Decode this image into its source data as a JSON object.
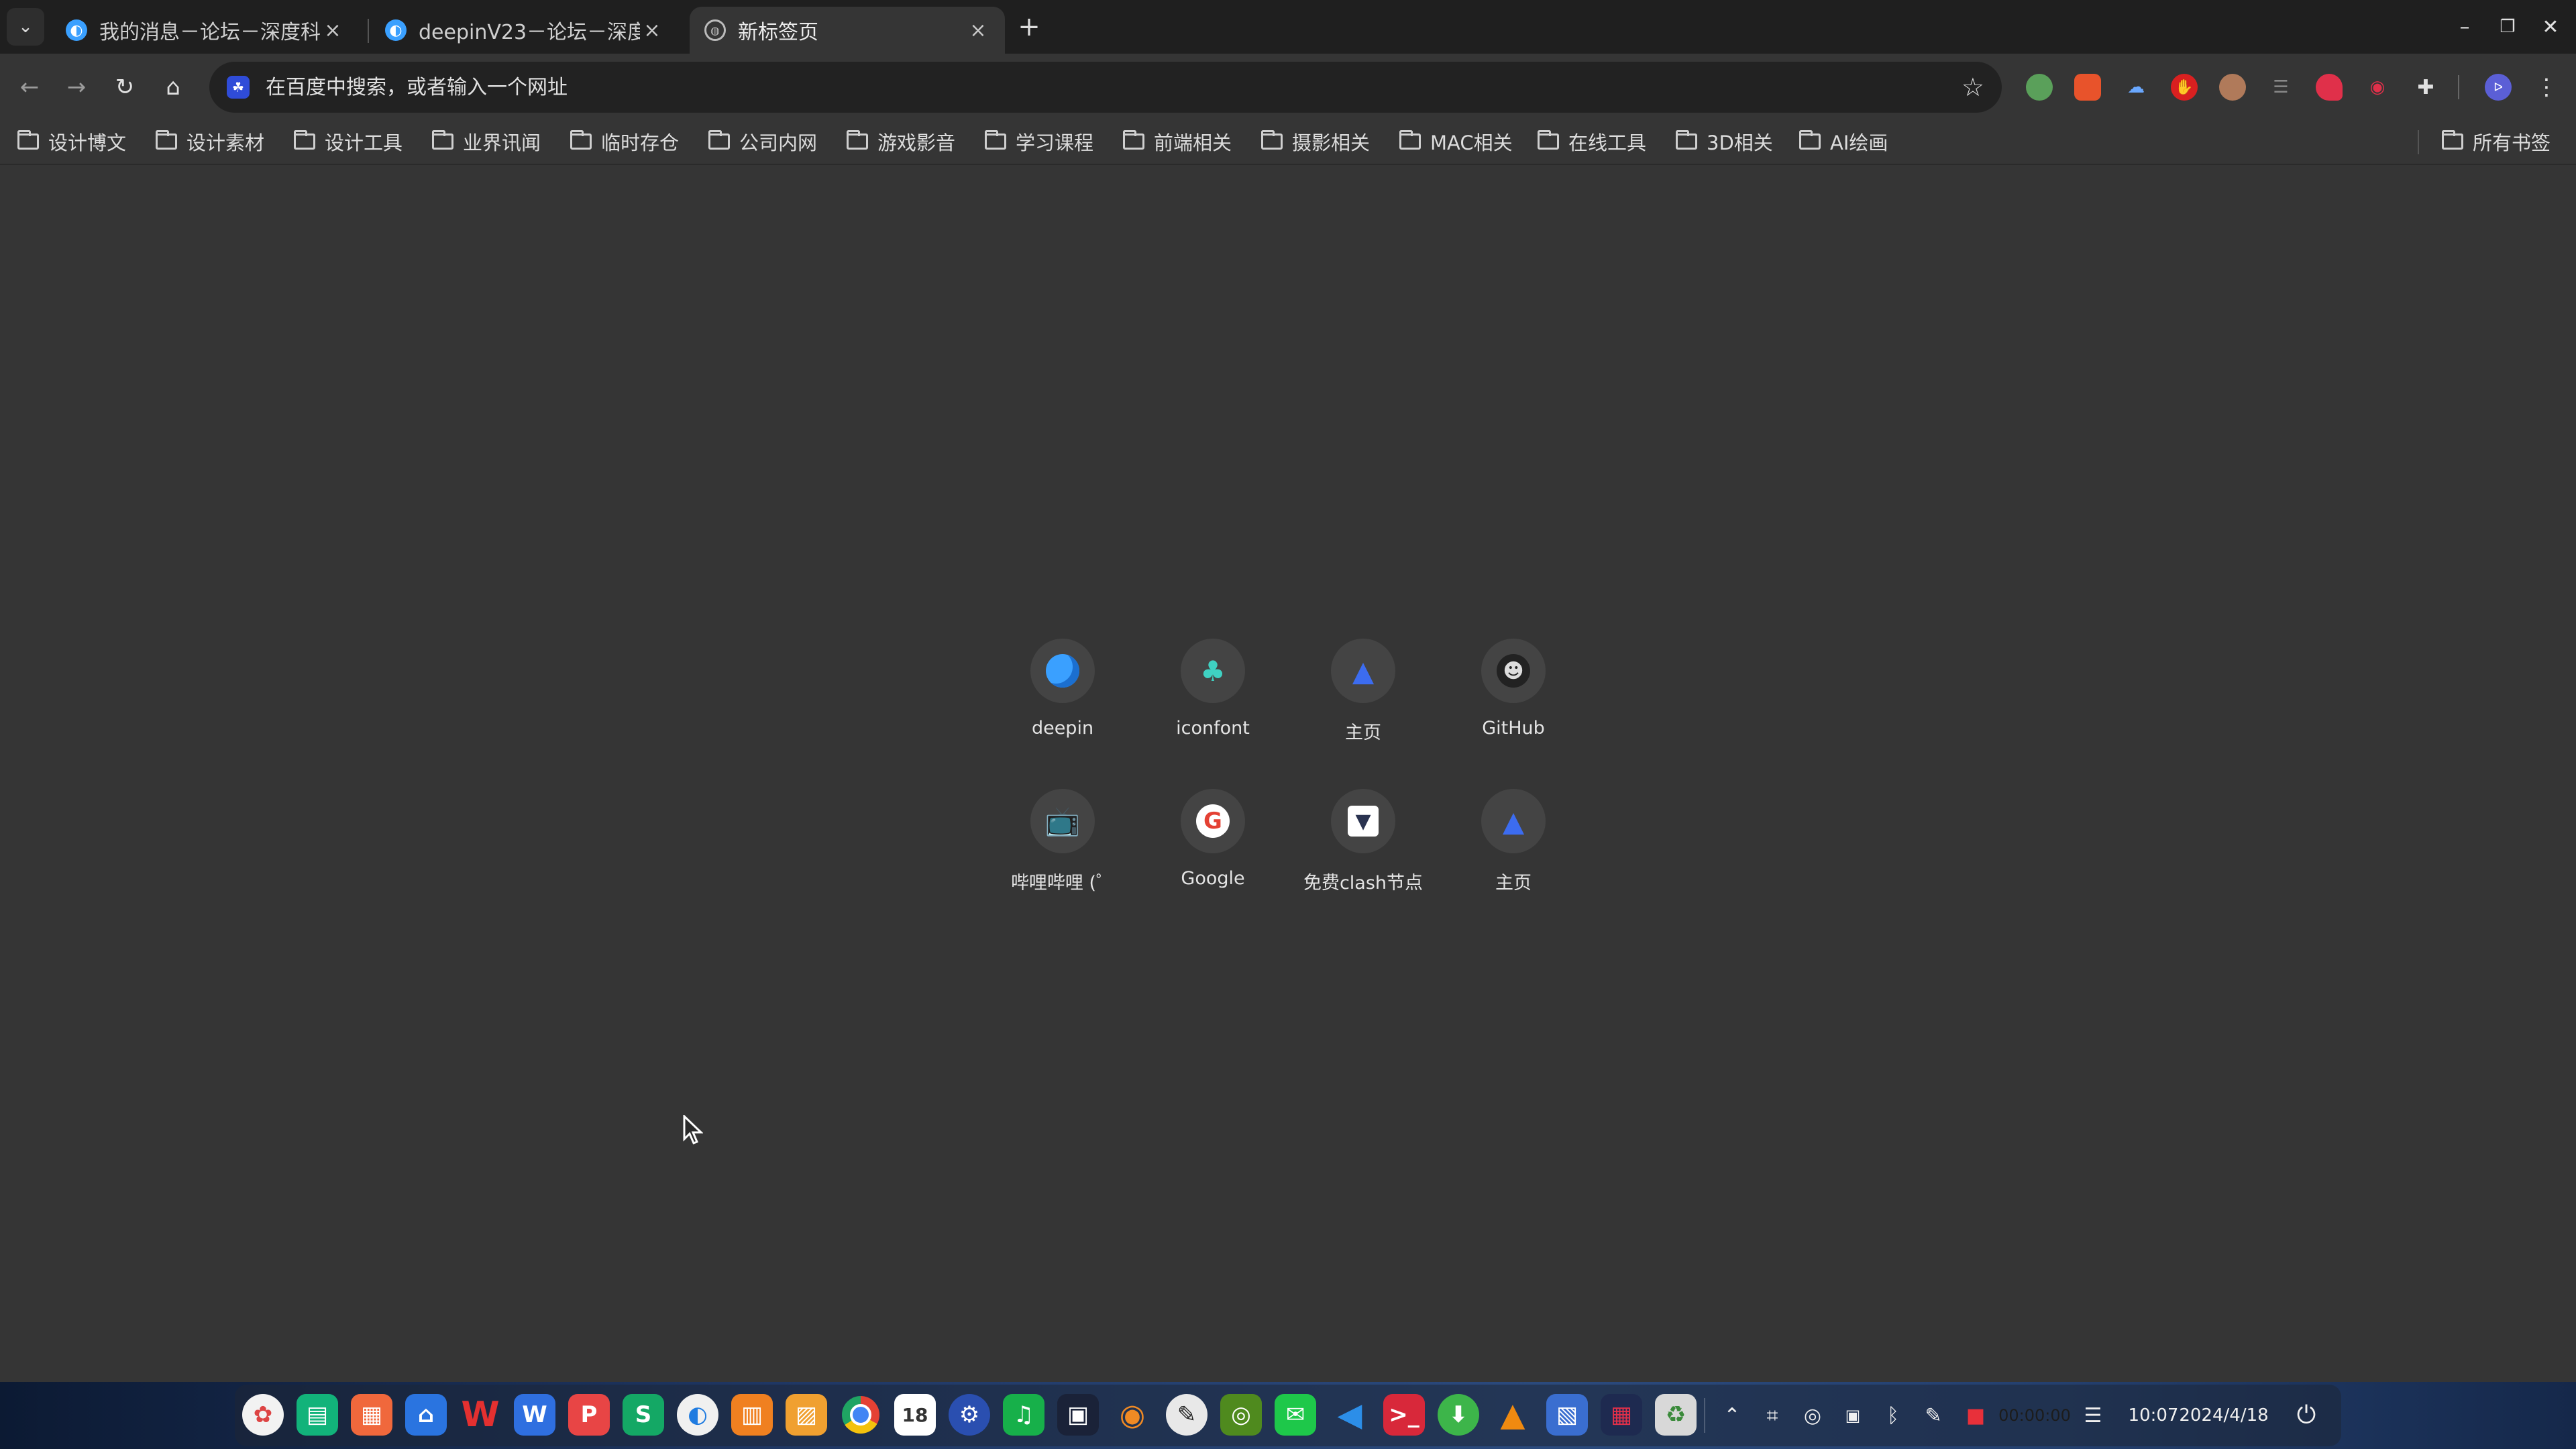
{
  "tabs": [
    {
      "title": "我的消息－论坛－深度科",
      "close": "×"
    },
    {
      "title": "deepinV23－论坛－深度",
      "close": "×"
    },
    {
      "title": "新标签页",
      "close": "×"
    }
  ],
  "tab_strip": {
    "dropdown": "⌄",
    "new_tab": "+"
  },
  "window_controls": {
    "minimize": "–",
    "maximize": "❐",
    "close": "✕"
  },
  "toolbar": {
    "back": "←",
    "forward": "→",
    "reload": "↻",
    "home": "⌂",
    "omnibox_placeholder": "在百度中搜索，或者输入一个网址",
    "search_engine_icon": "baidu-icon",
    "bookmark_star": "☆",
    "extensions_icon": "puzzle-icon",
    "profile_letter": "ᐅ",
    "menu": "⋮"
  },
  "bookmarks": [
    "设计博文",
    "设计素材",
    "设计工具",
    "业界讯闻",
    "临时存仓",
    "公司内网",
    "游戏影音",
    "学习课程",
    "前端相关",
    "摄影相关",
    "MAC相关",
    "在线工具",
    "3D相关",
    "AI绘画"
  ],
  "all_bookmarks": "所有书签",
  "shortcuts": [
    {
      "label": "deepin",
      "icon": "deepin-icon",
      "color": "#3aa0ff"
    },
    {
      "label": "iconfont",
      "icon": "iconfont-icon",
      "color": "#3fd1c2"
    },
    {
      "label": "主页",
      "icon": "mountain-logo-icon",
      "color": "#3c6cf0"
    },
    {
      "label": "GitHub",
      "icon": "github-icon",
      "color": "#2a2a2a"
    },
    {
      "label": "哔哩哔哩 (゜",
      "icon": "bilibili-icon",
      "color": "#1ea0e0"
    },
    {
      "label": "Google",
      "icon": "google-icon",
      "color": "#ffffff"
    },
    {
      "label": "免费clash节点",
      "icon": "cat-icon",
      "color": "#ffffff"
    },
    {
      "label": "主页",
      "icon": "mountain-logo-icon",
      "color": "#3c6cf0"
    }
  ],
  "taskbar": {
    "record_time": "00:00:00",
    "time": "10:07",
    "date": "2024/4/18"
  },
  "calendar_day": "18"
}
